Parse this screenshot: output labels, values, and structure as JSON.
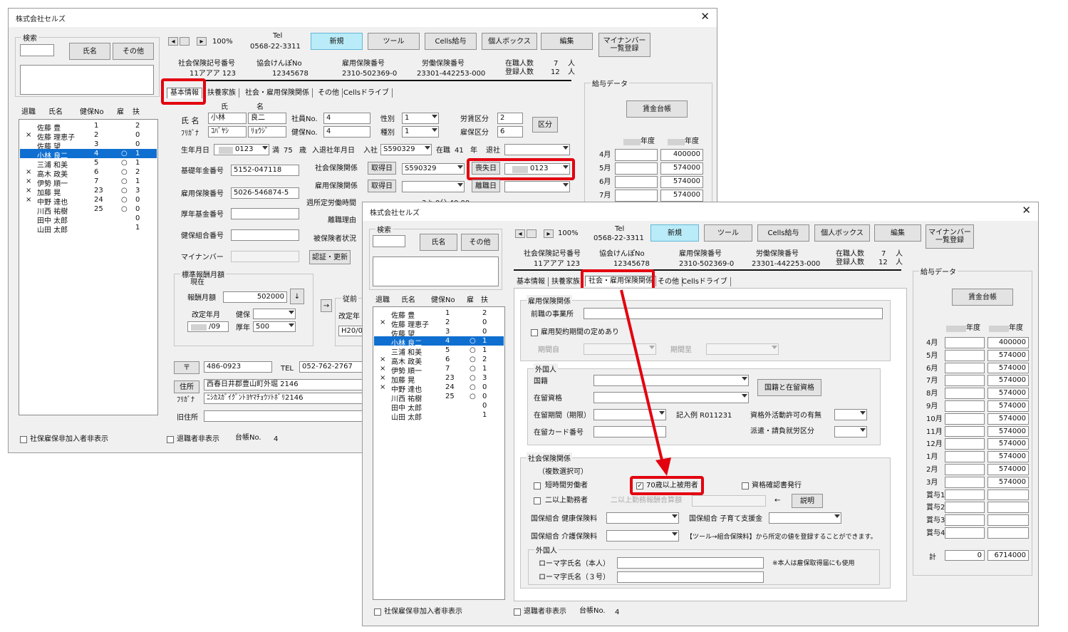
{
  "app": {
    "title": "株式会社セルズ",
    "close": "✕"
  },
  "search": {
    "title": "検索",
    "name_btn": "氏名",
    "other_btn": "その他"
  },
  "list": {
    "headers": [
      "退職",
      "氏名",
      "健保No",
      "雇",
      "扶"
    ],
    "rows": [
      {
        "mark": "",
        "name": "佐藤 豊",
        "no": "1",
        "emp": "",
        "dep": "2"
      },
      {
        "mark": "×",
        "name": "佐藤 理恵子",
        "no": "2",
        "emp": "",
        "dep": "0"
      },
      {
        "mark": "",
        "name": "佐藤 望",
        "no": "3",
        "emp": "",
        "dep": "0"
      },
      {
        "mark": "",
        "name": "小林 良二",
        "no": "4",
        "emp": "○",
        "dep": "1"
      },
      {
        "mark": "",
        "name": "三浦 和美",
        "no": "5",
        "emp": "○",
        "dep": "1"
      },
      {
        "mark": "×",
        "name": "高木 政美",
        "no": "6",
        "emp": "○",
        "dep": "2"
      },
      {
        "mark": "×",
        "name": "伊勢 順一",
        "no": "7",
        "emp": "○",
        "dep": "1"
      },
      {
        "mark": "×",
        "name": "加藤 晃",
        "no": "23",
        "emp": "○",
        "dep": "3"
      },
      {
        "mark": "×",
        "name": "中野 達也",
        "no": "24",
        "emp": "○",
        "dep": "0"
      },
      {
        "mark": "",
        "name": "川西 祐樹",
        "no": "25",
        "emp": "○",
        "dep": "0"
      },
      {
        "mark": "",
        "name": "田中 太郎",
        "no": "",
        "emp": "",
        "dep": "0"
      },
      {
        "mark": "",
        "name": "山田 太郎",
        "no": "",
        "emp": "",
        "dep": "1"
      }
    ]
  },
  "nav": {
    "zoom": "100%",
    "tel_label": "Tel",
    "tel": "0568-22-3311"
  },
  "toolbar": {
    "new": "新規",
    "tool": "ツール",
    "cells": "Cells給与",
    "personal": "個人ボックス",
    "edit": "編集",
    "myno_l1": "マイナンバー",
    "myno_l2": "一覧登録"
  },
  "company": {
    "sh_label": "社会保険記号番号",
    "sh": "11アアア 123",
    "kk_label": "協会けんぽNo",
    "kk": "12345678",
    "ki_label": "雇用保険番号",
    "ki": "2310-502369-0",
    "rs_label": "労働保険番号",
    "rs": "23301-442253-000",
    "zai_label": "在職人数",
    "zai": "7",
    "reg_label": "登録人数",
    "reg": "12",
    "unit": "人"
  },
  "tabs": {
    "basic": "基本情報",
    "dep": "扶養家族",
    "social": "社会・雇用保険関係",
    "other": "その他",
    "drive": "Cellsドライブ"
  },
  "basic": {
    "shi": "氏",
    "mei": "名",
    "name_label": "氏 名",
    "furi_label": "ﾌﾘｶﾞﾅ",
    "sei": "小林",
    "meim": "良二",
    "sei_k": "ｺﾊﾞﾔｼ",
    "mei_k": "ﾘｮｳｼﾞ",
    "empno_label": "社員No.",
    "empno": "4",
    "kenpo_label": "健保No.",
    "kenpo": "4",
    "sex_label": "性別",
    "sex": "1",
    "kind_label": "種別",
    "kind": "1",
    "rodo_label": "労賃区分",
    "rodo": "2",
    "koyo_label": "雇保区分",
    "koyo": "6",
    "kubun": "区分",
    "birth_label": "生年月日",
    "birth": "0123",
    "age": "満",
    "age_v": "75",
    "age_u": "歳",
    "joinret": "入退社年月日",
    "nyusha": "入社",
    "nyusha_v": "S590329",
    "zaishoku": "在職",
    "zaishoku_v": "41",
    "zaishoku_u": "年",
    "taisha": "退社",
    "kiso_label": "基礎年金番号",
    "kiso": "5152-047118",
    "shakai_label": "社会保険関係",
    "shutoku": "取得日",
    "shakai_date": "S590329",
    "soshitsu": "喪失日",
    "soshitsu_v": "0123",
    "koyoban_label": "雇用保険番号",
    "koyoban": "5026-546874-5",
    "koyokan_label": "雇用保険関係",
    "ritoku": "離職日",
    "kosei_label": "厚年基金番号",
    "shotei_label": "週所定労働時間",
    "shotei_v": "3 h 0分  40.00",
    "rishoku_label": "離職理由",
    "kenpokumi_label": "健保組合番号",
    "hihoken_label": "被保険者状況",
    "myno_label": "マイナンバー",
    "auth": "認証・更新",
    "std": "標準報酬月額",
    "current": "現在",
    "prev": "従前",
    "hoshu_label": "報酬月額",
    "hoshu": "502000",
    "arrow": "↓",
    "kaitei": "改定年月",
    "kaitei_v": "/09",
    "kenpo2": "健保",
    "kounen": "厚年",
    "kounen_v": "500",
    "kaitei2": "改定年",
    "h20": "H20/0",
    "yubin": "〒",
    "zip": "486-0923",
    "tel_l": "TEL",
    "tel": "052-762-2767",
    "jusho": "住所",
    "addr": "西春日井郡豊山町外堀 2146",
    "furi2": "ﾌﾘｶﾞﾅ",
    "addr_k": "ﾆｼｶｽｶﾞｲｸﾞﾝﾄﾖﾔﾏﾁｮｳｿﾄﾎﾞﾘ2146",
    "old": "旧住所"
  },
  "salary": {
    "title": "給与データ",
    "ledger": "賃金台帳",
    "nendo": "年度",
    "months": [
      "4月",
      "5月",
      "6月",
      "7月",
      "8月",
      "9月",
      "10月",
      "11月",
      "12月",
      "1月",
      "2月",
      "3月",
      "賞与1",
      "賞与2",
      "賞与3",
      "賞与4"
    ],
    "values": [
      "400000",
      "574000",
      "574000",
      "574000",
      "574000",
      "574000",
      "574000",
      "574000",
      "574000",
      "574000",
      "574000",
      "574000",
      "",
      "",
      "",
      ""
    ],
    "total_label": "計",
    "total_prev": "0",
    "total": "6714000"
  },
  "footer": {
    "hide_uninsured": "社保雇保非加入者非表示",
    "hide_retired": "退職者非表示",
    "ledger_no_label": "台帳No.",
    "ledger_no": "4"
  },
  "social": {
    "koyo_grp": "雇用保険関係",
    "prev_job": "前職の事業所",
    "contract": "雇用契約期間の定めあり",
    "kikan_from": "期間自",
    "kikan_to": "期間至",
    "foreign": "外国人",
    "kokuseki": "国籍",
    "zairyu": "在留資格",
    "zairyu_kikan": "在留期間（期限）",
    "kinyu": "記入例  R011231",
    "card": "在留カード番号",
    "btn_kokuseki": "国籍と在留資格",
    "shikakugai": "資格外活動許可の有無",
    "haken": "派遣・請負就労区分",
    "shaho_grp": "社会保険関係",
    "multi": "（複数選択可）",
    "tanjikan": "短時間労働者",
    "over70": "70歳以上被用者",
    "shikaku": "資格確認書発行",
    "nijou": "二以上勤務者",
    "nijou_sanpu": "二以上勤務報酬合算額",
    "arrow_l": "←",
    "setsumei": "説明",
    "kumiai_kenpo": "国保組合  健康保険料",
    "kumiai_kosodate": "国保組合  子育て支援金",
    "kumiai_kaigo": "国保組合  介護保険料",
    "kumiai_note": "【ツール→組合保険料】から所定の値を登録することができます。",
    "foreign2": "外国人",
    "roma": "ローマ字氏名（本人）",
    "roma3": "ローマ字氏名（３号）",
    "roma_note": "※本人は雇保取得届にも使用"
  }
}
